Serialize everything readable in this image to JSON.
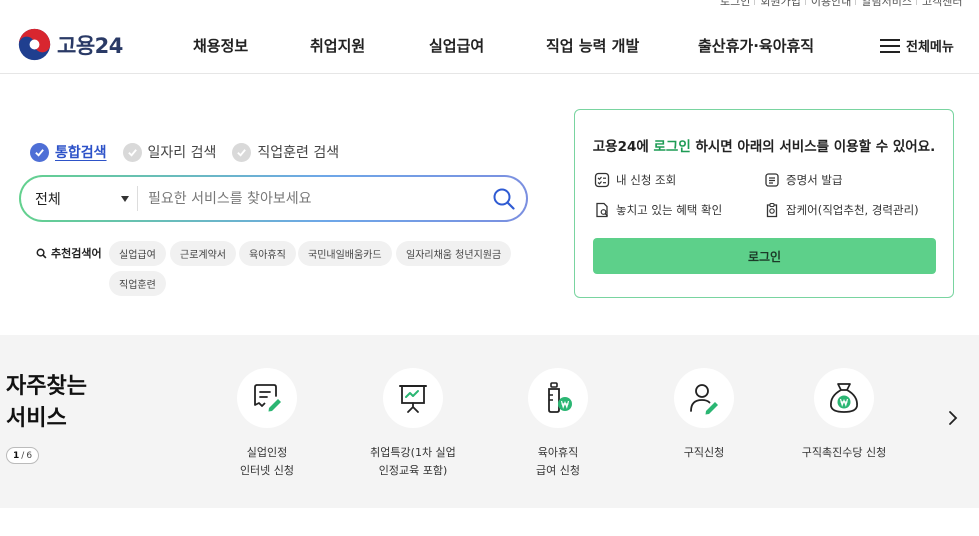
{
  "utility": [
    "로그인",
    "회원가입",
    "이용안내",
    "알림서비스",
    "고객센터"
  ],
  "header": {
    "logo_text": "고용24",
    "nav": [
      "채용정보",
      "취업지원",
      "실업급여",
      "직업 능력 개발",
      "출산휴가·육아휴직"
    ],
    "all_menu": "전체메뉴"
  },
  "search": {
    "tabs": [
      {
        "label": "통합검색",
        "active": true
      },
      {
        "label": "일자리 검색",
        "active": false
      },
      {
        "label": "직업훈련 검색",
        "active": false
      }
    ],
    "category": "전체",
    "placeholder": "필요한 서비스를 찾아보세요"
  },
  "recommend": {
    "label": "추천검색어",
    "keywords": [
      "실업급여",
      "근로계약서",
      "육아휴직",
      "국민내일배움카드",
      "일자리채움 청년지원금",
      "직업훈련"
    ]
  },
  "login_panel": {
    "title_prefix": "고용24에 ",
    "title_highlight": "로그인",
    "title_suffix": " 하시면 아래의 서비스를 이용할 수 있어요.",
    "items": [
      "내 신청 조회",
      "증명서 발급",
      "놓치고 있는 혜택 확인",
      "잡케어(직업추천, 경력관리)"
    ],
    "button": "로그인",
    "colors": {
      "border": "#79d4a0",
      "button": "#5dd08a",
      "highlight": "#1e9c55"
    }
  },
  "frequent": {
    "title_line1": "자주찾는",
    "title_line2": "서비스",
    "page_current": "1",
    "page_total": "6",
    "services": [
      {
        "name": "실업인정\n인터넷 신청",
        "icon": "document-pen-icon"
      },
      {
        "name": "취업특강(1차 실업\n인정교육 포함)",
        "icon": "presentation-board-icon"
      },
      {
        "name": "육아휴직\n급여 신청",
        "icon": "baby-bottle-won-icon"
      },
      {
        "name": "구직신청",
        "icon": "person-pen-icon"
      },
      {
        "name": "구직촉진수당 신청",
        "icon": "money-bag-won-icon"
      }
    ]
  }
}
